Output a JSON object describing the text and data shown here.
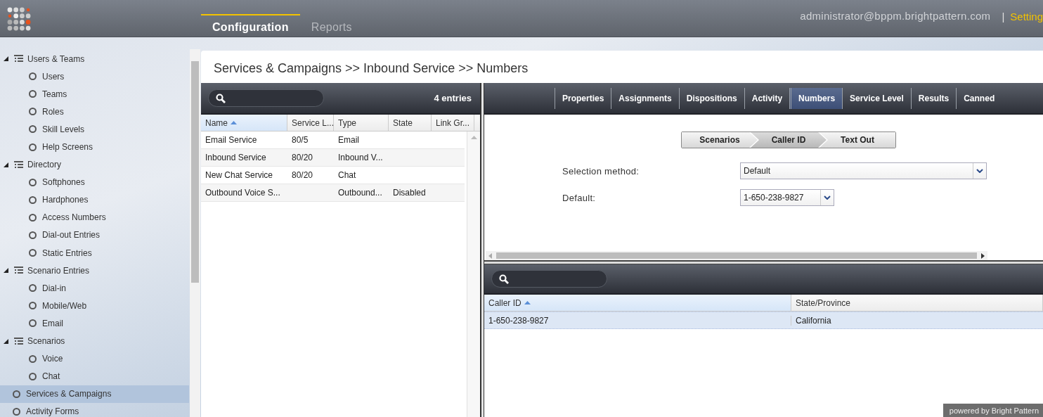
{
  "header": {
    "nav": [
      {
        "label": "Configuration",
        "selected": true
      },
      {
        "label": "Reports",
        "selected": false
      }
    ],
    "user": "administrator@bppm.brightpattern.com",
    "separator": "|",
    "settings_link": "Setting"
  },
  "sidebar": {
    "items": [
      {
        "label": "Users & Teams",
        "kind": "group",
        "expanded": true,
        "selected": false,
        "children": [
          {
            "label": "Users",
            "selected": false
          },
          {
            "label": "Teams",
            "selected": false
          },
          {
            "label": "Roles",
            "selected": false
          },
          {
            "label": "Skill Levels",
            "selected": false
          },
          {
            "label": "Help Screens",
            "selected": false
          }
        ]
      },
      {
        "label": "Directory",
        "kind": "group",
        "expanded": true,
        "selected": false,
        "children": [
          {
            "label": "Softphones",
            "selected": false
          },
          {
            "label": "Hardphones",
            "selected": false
          },
          {
            "label": "Access Numbers",
            "selected": false
          },
          {
            "label": "Dial-out Entries",
            "selected": false
          },
          {
            "label": "Static Entries",
            "selected": false
          }
        ]
      },
      {
        "label": "Scenario Entries",
        "kind": "group",
        "expanded": true,
        "selected": false,
        "children": [
          {
            "label": "Dial-in",
            "selected": false
          },
          {
            "label": "Mobile/Web",
            "selected": false
          },
          {
            "label": "Email",
            "selected": false
          }
        ]
      },
      {
        "label": "Scenarios",
        "kind": "group",
        "expanded": true,
        "selected": false,
        "children": [
          {
            "label": "Voice",
            "selected": false
          },
          {
            "label": "Chat",
            "selected": false
          }
        ]
      },
      {
        "label": "Services & Campaigns",
        "kind": "item",
        "selected": true
      },
      {
        "label": "Activity Forms",
        "kind": "item",
        "selected": false
      }
    ]
  },
  "breadcrumb": "Services & Campaigns >> Inbound Service >> Numbers",
  "services_list": {
    "count": "4 entries",
    "columns": [
      {
        "label": "Name",
        "sorted": true
      },
      {
        "label": "Service L...",
        "sorted": false
      },
      {
        "label": "Type",
        "sorted": false
      },
      {
        "label": "State",
        "sorted": false
      },
      {
        "label": "Link Gr...",
        "sorted": false
      }
    ],
    "rows": [
      {
        "cells": [
          "Email Service",
          "80/5",
          "Email",
          ""
        ],
        "selected": false
      },
      {
        "cells": [
          "Inbound Service",
          "80/20",
          "Inbound V...",
          ""
        ],
        "selected": false
      },
      {
        "cells": [
          "New Chat Service",
          "80/20",
          "Chat",
          ""
        ],
        "selected": false
      },
      {
        "cells": [
          "Outbound Voice S...",
          "",
          "Outbound...",
          "Disabled"
        ],
        "selected": false
      }
    ]
  },
  "tabs": [
    {
      "label": "Properties",
      "selected": false
    },
    {
      "label": "Assignments",
      "selected": false
    },
    {
      "label": "Dispositions",
      "selected": false
    },
    {
      "label": "Activity",
      "selected": false
    },
    {
      "label": "Numbers",
      "selected": true
    },
    {
      "label": "Service Level",
      "selected": false
    },
    {
      "label": "Results",
      "selected": false
    },
    {
      "label": "Canned",
      "selected": false
    }
  ],
  "steps": [
    {
      "label": "Scenarios",
      "selected": false
    },
    {
      "label": "Caller ID",
      "selected": true
    },
    {
      "label": "Text Out",
      "selected": false
    }
  ],
  "form": {
    "selection_method": {
      "label": "Selection method:",
      "value": "Default"
    },
    "default": {
      "label": "Default:",
      "value": "1-650-238-9827"
    }
  },
  "caller_ids": {
    "columns": [
      {
        "label": "Caller ID",
        "sorted": true
      },
      {
        "label": "State/Province",
        "sorted": false
      }
    ],
    "rows": [
      {
        "cells": [
          "1-650-238-9827",
          "California"
        ],
        "selected": true
      }
    ]
  },
  "footer": "powered by Bright Pattern"
}
